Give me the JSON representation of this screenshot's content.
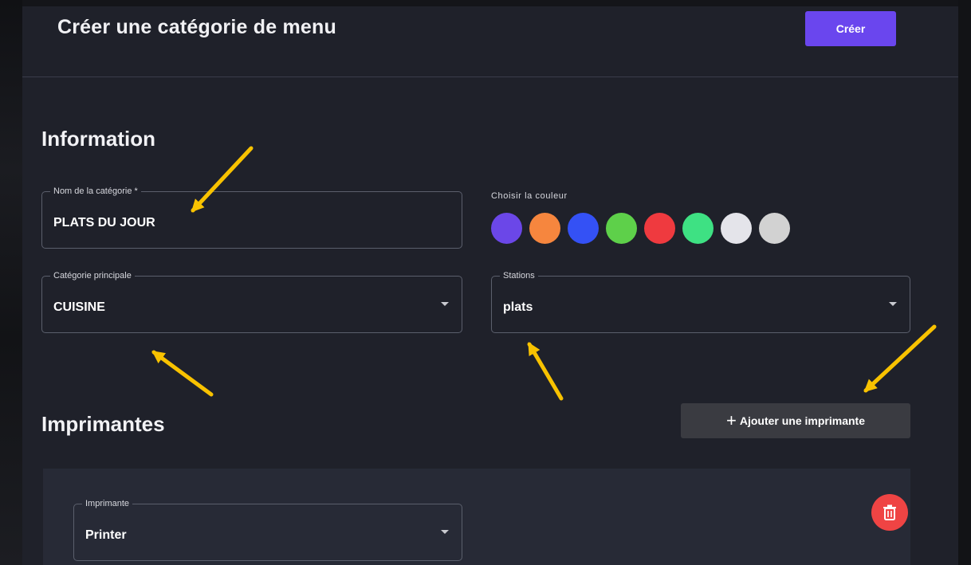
{
  "header": {
    "title": "Créer une catégorie de menu",
    "create_label": "Créer"
  },
  "information": {
    "title": "Information",
    "category_name": {
      "label": "Nom de la catégorie *",
      "value": "PLATS DU JOUR"
    },
    "color_picker": {
      "label": "Choisir la couleur",
      "colors": [
        "#6b47e8",
        "#f6863e",
        "#3451f5",
        "#5ed04a",
        "#ef3a3f",
        "#3ee183",
        "#e4e4ea",
        "#d2d2d2"
      ]
    },
    "main_category": {
      "label": "Catégorie principale",
      "value": "CUISINE"
    },
    "stations": {
      "label": "Stations",
      "value": "plats"
    }
  },
  "printers": {
    "title": "Imprimantes",
    "add_label": "Ajouter une imprimante",
    "printer_field": {
      "label": "Imprimante",
      "value": "Printer"
    }
  },
  "colors": {
    "accent": "#6a46ee",
    "danger": "#ef4444",
    "annotation_arrow": "#f8c200"
  }
}
